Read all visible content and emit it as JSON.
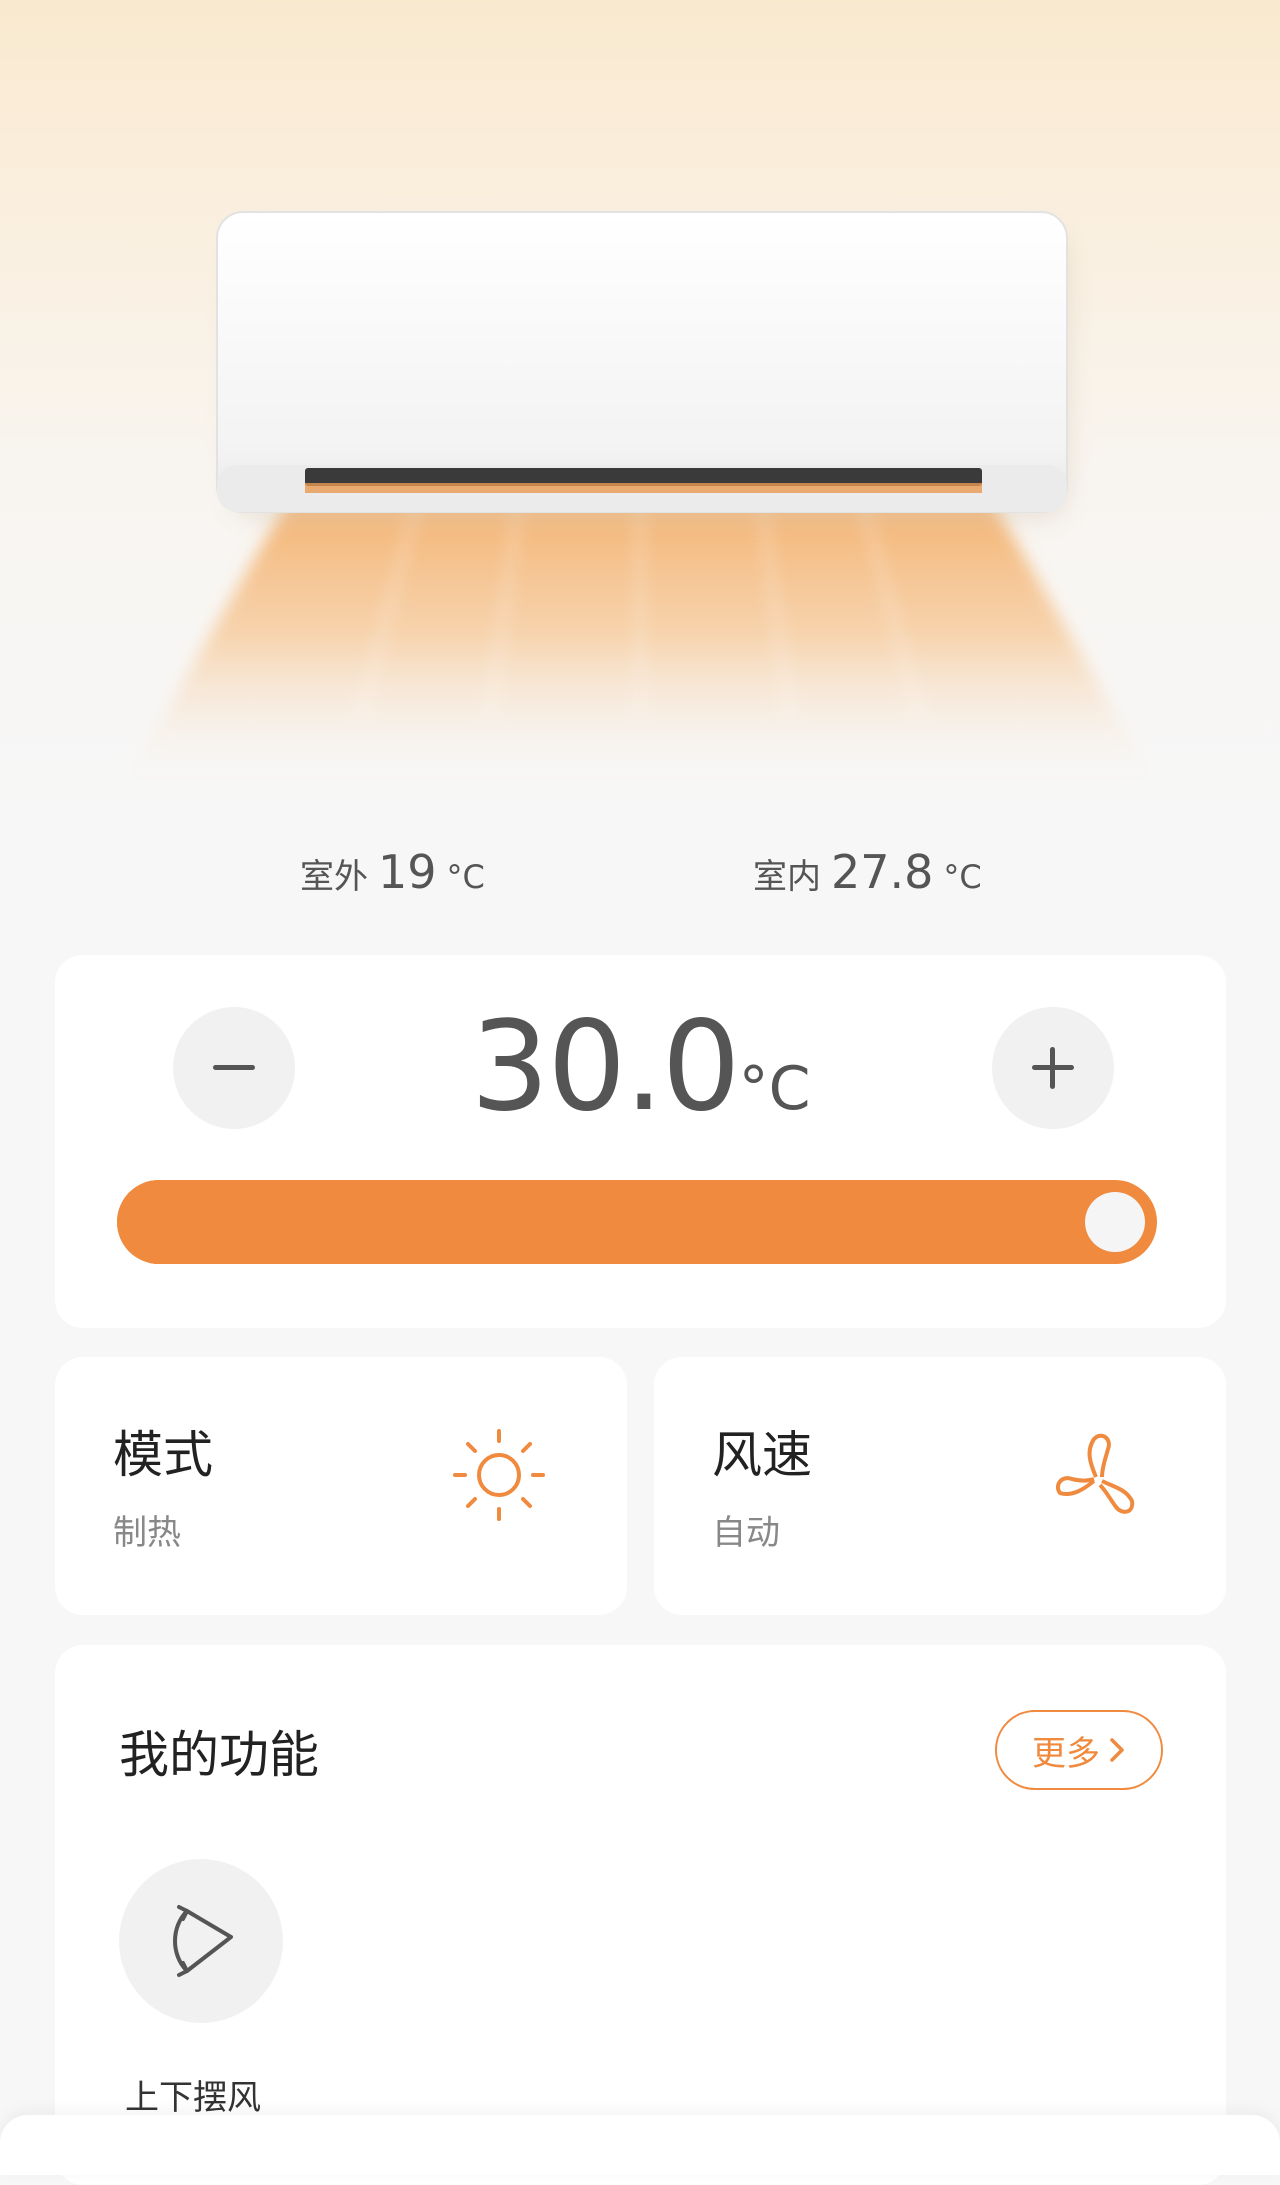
{
  "status": {
    "outdoor_label": "室外",
    "outdoor_value": "19",
    "outdoor_unit": "°C",
    "indoor_label": "室内",
    "indoor_value": "27.8",
    "indoor_unit": "°C"
  },
  "temperature": {
    "setpoint": "30.0",
    "unit": "°C",
    "slider_level": 1.0
  },
  "mode": {
    "title": "模式",
    "value": "制热",
    "icon": "sun-icon"
  },
  "fan": {
    "title": "风速",
    "value": "自动",
    "icon": "fan-icon"
  },
  "functions": {
    "title": "我的功能",
    "more_label": "更多",
    "items": [
      {
        "label": "上下摆风",
        "icon": "vertical-swing-icon"
      }
    ]
  },
  "colors": {
    "accent": "#ef8a3e",
    "hero_top": "#f9e9cf",
    "card_bg": "#ffffff",
    "page_bg": "#f7f7f7"
  }
}
